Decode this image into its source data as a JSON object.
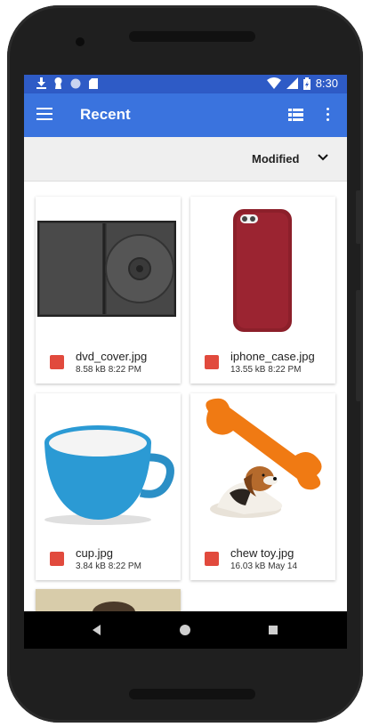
{
  "status_bar": {
    "time": "8:30"
  },
  "toolbar": {
    "title": "Recent"
  },
  "sort": {
    "label": "Modified"
  },
  "files": [
    {
      "name": "dvd_cover.jpg",
      "meta": "8.58 kB 8:22 PM"
    },
    {
      "name": "iphone_case.jpg",
      "meta": "13.55 kB 8:22 PM"
    },
    {
      "name": "cup.jpg",
      "meta": "3.84 kB 8:22 PM"
    },
    {
      "name": "chew toy.jpg",
      "meta": "16.03 kB May 14"
    }
  ],
  "colors": {
    "statusbar": "#2e5bc6",
    "toolbar": "#3a73de",
    "image_icon": "#e14a3d"
  },
  "icons": [
    "download-icon",
    "keyhole-icon",
    "sync-icon",
    "sd-card-icon",
    "wifi-icon",
    "signal-icon",
    "battery-charging-icon",
    "menu-icon",
    "grid-view-icon",
    "more-vert-icon",
    "chevron-down-icon",
    "image-file-icon",
    "nav-back-icon",
    "nav-home-icon",
    "nav-recents-icon"
  ]
}
